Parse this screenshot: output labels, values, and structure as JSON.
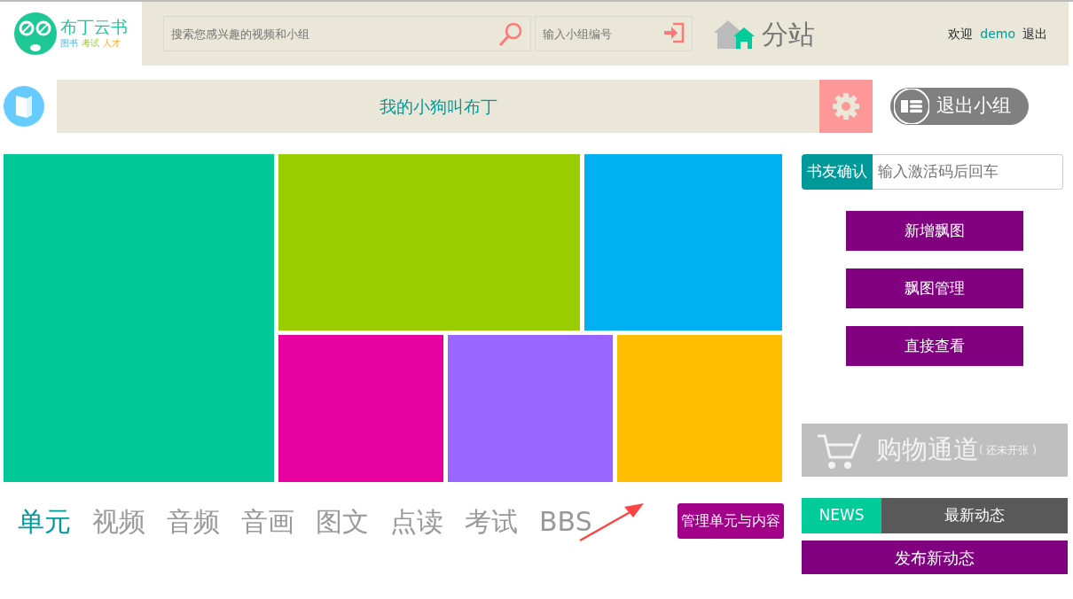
{
  "logo": {
    "name": "布丁云书",
    "tags": [
      "图书",
      "考试",
      "人才"
    ]
  },
  "search": {
    "placeholder": "搜索您感兴趣的视频和小组"
  },
  "group_code": {
    "placeholder": "输入小组编号"
  },
  "substation": "分站",
  "user": {
    "greeting": "欢迎",
    "name": "demo",
    "logout": "退出"
  },
  "group": {
    "title": "我的小狗叫布丁",
    "exit": "退出小组"
  },
  "tiles": [
    {
      "color": "#00c896"
    },
    {
      "color": "#9acd00"
    },
    {
      "color": "#00b0f0"
    },
    {
      "color": "#e600a0"
    },
    {
      "color": "#9966ff"
    },
    {
      "color": "#ffbf00"
    }
  ],
  "activation": {
    "label": "书友确认",
    "placeholder": "输入激活码后回车"
  },
  "side_buttons": [
    "新增飘图",
    "飘图管理",
    "直接查看"
  ],
  "shop": {
    "title": "购物通道",
    "note": "( 还未开张 )"
  },
  "tabs": [
    {
      "label": "单元",
      "selected": true
    },
    {
      "label": "视频",
      "selected": false
    },
    {
      "label": "音频",
      "selected": false
    },
    {
      "label": "音画",
      "selected": false
    },
    {
      "label": "图文",
      "selected": false
    },
    {
      "label": "点读",
      "selected": false
    },
    {
      "label": "考试",
      "selected": false
    },
    {
      "label": "BBS",
      "selected": false
    }
  ],
  "manage_button": "管理单元与内容",
  "news": {
    "tag": "NEWS",
    "title": "最新动态",
    "post": "发布新动态"
  }
}
